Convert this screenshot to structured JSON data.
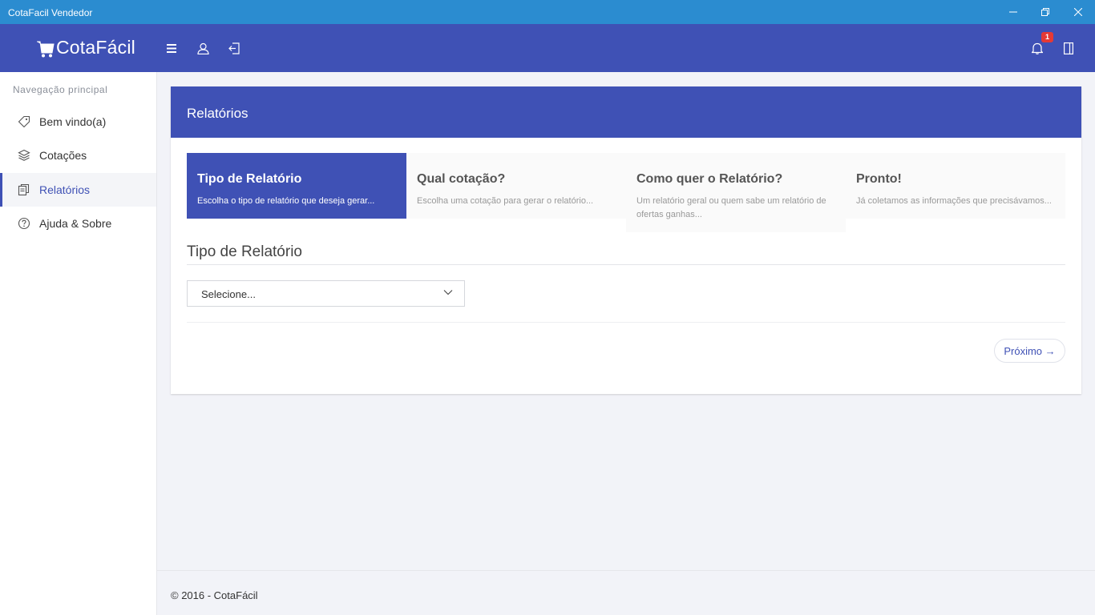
{
  "window": {
    "title": "CotaFacil Vendedor",
    "controls": [
      "minimize-icon",
      "restore-icon",
      "close-icon"
    ]
  },
  "topbar": {
    "logo_text": "CotaFácil",
    "buttons": [
      "menu-icon",
      "user-icon",
      "logout-icon"
    ],
    "notification_count": "1",
    "right_buttons": [
      "bell-icon",
      "panel-icon"
    ]
  },
  "sidebar": {
    "heading": "Navegação principal",
    "items": [
      {
        "label": "Bem vindo(a)",
        "icon": "tag-icon",
        "active": false
      },
      {
        "label": "Cotações",
        "icon": "layers-icon",
        "active": false
      },
      {
        "label": "Relatórios",
        "icon": "documents-icon",
        "active": true
      },
      {
        "label": "Ajuda & Sobre",
        "icon": "help-icon",
        "active": false
      }
    ]
  },
  "main": {
    "card_title": "Relatórios",
    "steps": [
      {
        "title": "Tipo de Relatório",
        "description": "Escolha o tipo de relatório que deseja gerar...",
        "active": true
      },
      {
        "title": "Qual cotação?",
        "description": "Escolha uma cotação para gerar o relatório...",
        "active": false
      },
      {
        "title": "Como quer o Relatório?",
        "description": "Um relatório geral ou quem sabe um relatório de ofertas ganhas...",
        "active": false
      },
      {
        "title": "Pronto!",
        "description": "Já coletamos as informações que precisávamos...",
        "active": false
      }
    ],
    "section_title": "Tipo de Relatório",
    "select_value": "Selecione...",
    "next_label": "Próximo →"
  },
  "footer": {
    "text": "© 2016 - CotaFácil"
  },
  "colors": {
    "primary": "#3f51b5",
    "titlebar": "#2b8cd0",
    "badge": "#e53935"
  }
}
